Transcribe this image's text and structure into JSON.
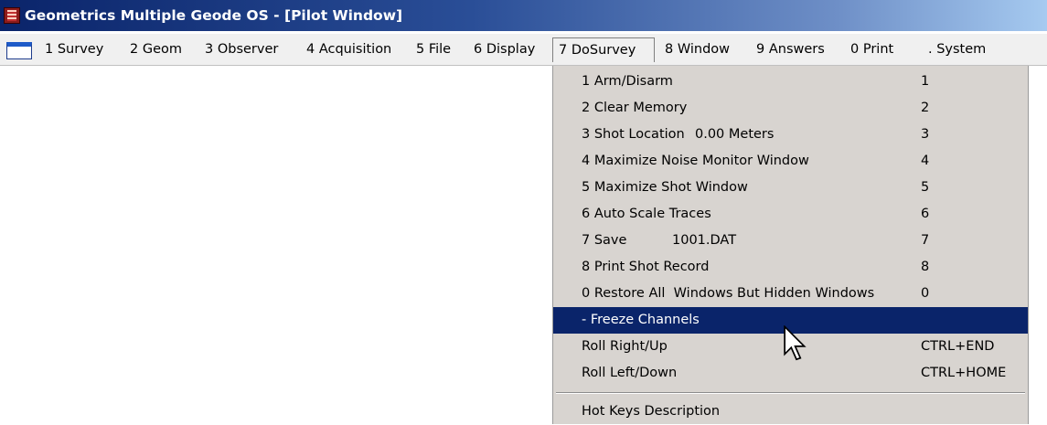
{
  "window": {
    "title": "Geometrics Multiple Geode OS - [Pilot Window]"
  },
  "menubar": {
    "items": [
      {
        "label": "1 Survey"
      },
      {
        "label": "2 Geom"
      },
      {
        "label": "3 Observer"
      },
      {
        "label": "4 Acquisition"
      },
      {
        "label": "5 File"
      },
      {
        "label": "6 Display"
      },
      {
        "label": "7 DoSurvey",
        "active": true
      },
      {
        "label": "8 Window"
      },
      {
        "label": "9 Answers"
      },
      {
        "label": "0 Print"
      },
      {
        "label": ". System"
      }
    ]
  },
  "dosurvey_menu": {
    "items": [
      {
        "label": "1 Arm/Disarm",
        "shortcut": "1"
      },
      {
        "label": "2 Clear Memory",
        "shortcut": "2"
      },
      {
        "label": "3 Shot Location",
        "value": "0.00 Meters",
        "shortcut": "3"
      },
      {
        "label": "4 Maximize Noise Monitor Window",
        "shortcut": "4"
      },
      {
        "label": "5 Maximize Shot Window",
        "shortcut": "5"
      },
      {
        "label": "6 Auto Scale Traces",
        "shortcut": "6"
      },
      {
        "label": "7 Save",
        "value": "1001.DAT",
        "shortcut": "7"
      },
      {
        "label": "8 Print Shot Record",
        "shortcut": "8"
      },
      {
        "label": "0 Restore All  Windows But Hidden Windows",
        "shortcut": "0"
      },
      {
        "label": "- Freeze Channels",
        "shortcut": "",
        "selected": true
      },
      {
        "label": "Roll Right/Up",
        "shortcut": "CTRL+END"
      },
      {
        "label": "Roll Left/Down",
        "shortcut": "CTRL+HOME"
      },
      {
        "label": "Hot Keys Description",
        "shortcut": ""
      }
    ]
  },
  "colors": {
    "title_start": "#0a246a",
    "title_end": "#a6caf0",
    "menu_bg": "#d8d4d0",
    "selection": "#0a246a"
  },
  "icons": {
    "app": "geode-app-icon",
    "document": "document-window-icon",
    "cursor": "arrow-cursor-icon"
  }
}
